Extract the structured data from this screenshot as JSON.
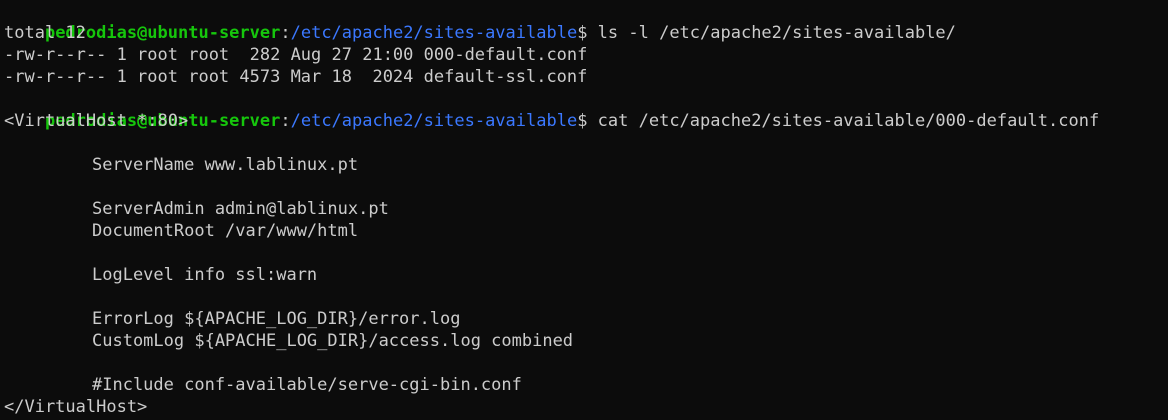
{
  "prompt": {
    "user_host": "pedrodias@ubuntu-server",
    "separator": ":",
    "cwd": "/etc/apache2/sites-available",
    "symbol": "$"
  },
  "commands": [
    " ls -l /etc/apache2/sites-available/",
    " cat /etc/apache2/sites-available/000-default.conf"
  ],
  "ls_output": [
    "total 12",
    "-rw-r--r-- 1 root root  282 Aug 27 21:00 000-default.conf",
    "-rw-r--r-- 1 root root 4573 Mar 18  2024 default-ssl.conf"
  ],
  "conf": {
    "open_tag": "<VirtualHost *:80>",
    "server_name": "ServerName www.lablinux.pt",
    "server_admin": "ServerAdmin admin@lablinux.pt",
    "document_root": "DocumentRoot /var/www/html",
    "log_level": "LogLevel info ssl:warn",
    "error_log": "ErrorLog ${APACHE_LOG_DIR}/error.log",
    "custom_log": "CustomLog ${APACHE_LOG_DIR}/access.log combined",
    "include": "#Include conf-available/serve-cgi-bin.conf",
    "close_tag": "</VirtualHost>"
  },
  "colors": {
    "background": "#0c0c0c",
    "text": "#cccccc",
    "user_host": "#16c60c",
    "path": "#3b78ff"
  }
}
